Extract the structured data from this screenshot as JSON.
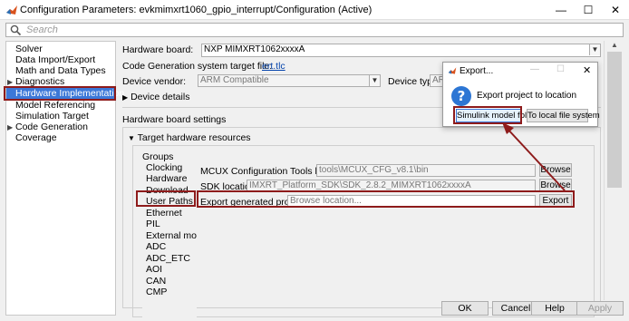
{
  "window": {
    "title": "Configuration Parameters: evkmimxrt1060_gpio_interrupt/Configuration (Active)",
    "controls": [
      "—",
      "☐",
      "✕"
    ]
  },
  "search": {
    "placeholder": "Search"
  },
  "tree": {
    "items": [
      {
        "label": "Solver",
        "expandable": false
      },
      {
        "label": "Data Import/Export",
        "expandable": false
      },
      {
        "label": "Math and Data Types",
        "expandable": false
      },
      {
        "label": "Diagnostics",
        "expandable": true
      },
      {
        "label": "Hardware Implementation",
        "expandable": false,
        "selected": true
      },
      {
        "label": "Model Referencing",
        "expandable": false
      },
      {
        "label": "Simulation Target",
        "expandable": false
      },
      {
        "label": "Code Generation",
        "expandable": true
      },
      {
        "label": "Coverage",
        "expandable": false
      }
    ]
  },
  "main": {
    "hardware_board_label": "Hardware board:",
    "hardware_board_value": "NXP MIMXRT1062xxxxA",
    "target_file_label": "Code Generation system target file:",
    "target_file_link": "ert.tlc",
    "device_vendor_label": "Device vendor:",
    "device_vendor_value": "ARM Compatible",
    "device_type_label": "Device type:",
    "device_type_value": "AR",
    "device_details": "Device details",
    "board_settings": "Hardware board settings",
    "target_resources": "Target hardware resources",
    "groups_label": "Groups",
    "groups": [
      "Clocking",
      "Hardware",
      "Download",
      "User Paths",
      "Ethernet",
      "PIL",
      "External mode",
      "ADC",
      "ADC_ETC",
      "AOI",
      "CAN",
      "CMP"
    ],
    "mcux_label": "MCUX Configuration Tools location:",
    "mcux_value": "tools\\MCUX_CFG_v8.1\\bin",
    "sdk_label": "SDK location:",
    "sdk_value": "IMXRT_Platform_SDK\\SDK_2.8.2_MIMXRT1062xxxxA",
    "export_label": "Export generated projects:",
    "export_placeholder": "Browse location...",
    "browse": "Browse",
    "export_btn": "Export"
  },
  "dialog": {
    "title": "Export...",
    "message": "Export project to location",
    "btn_simulink": "Simulink model folder",
    "btn_filesystem": "To local file system",
    "controls": [
      "—",
      "☐",
      "✕"
    ]
  },
  "footer": {
    "ok": "OK",
    "cancel": "Cancel",
    "help": "Help",
    "apply": "Apply"
  },
  "colors": {
    "selection": "#3c78d8",
    "annotation": "#8e1b1b",
    "link": "#0645ad"
  }
}
